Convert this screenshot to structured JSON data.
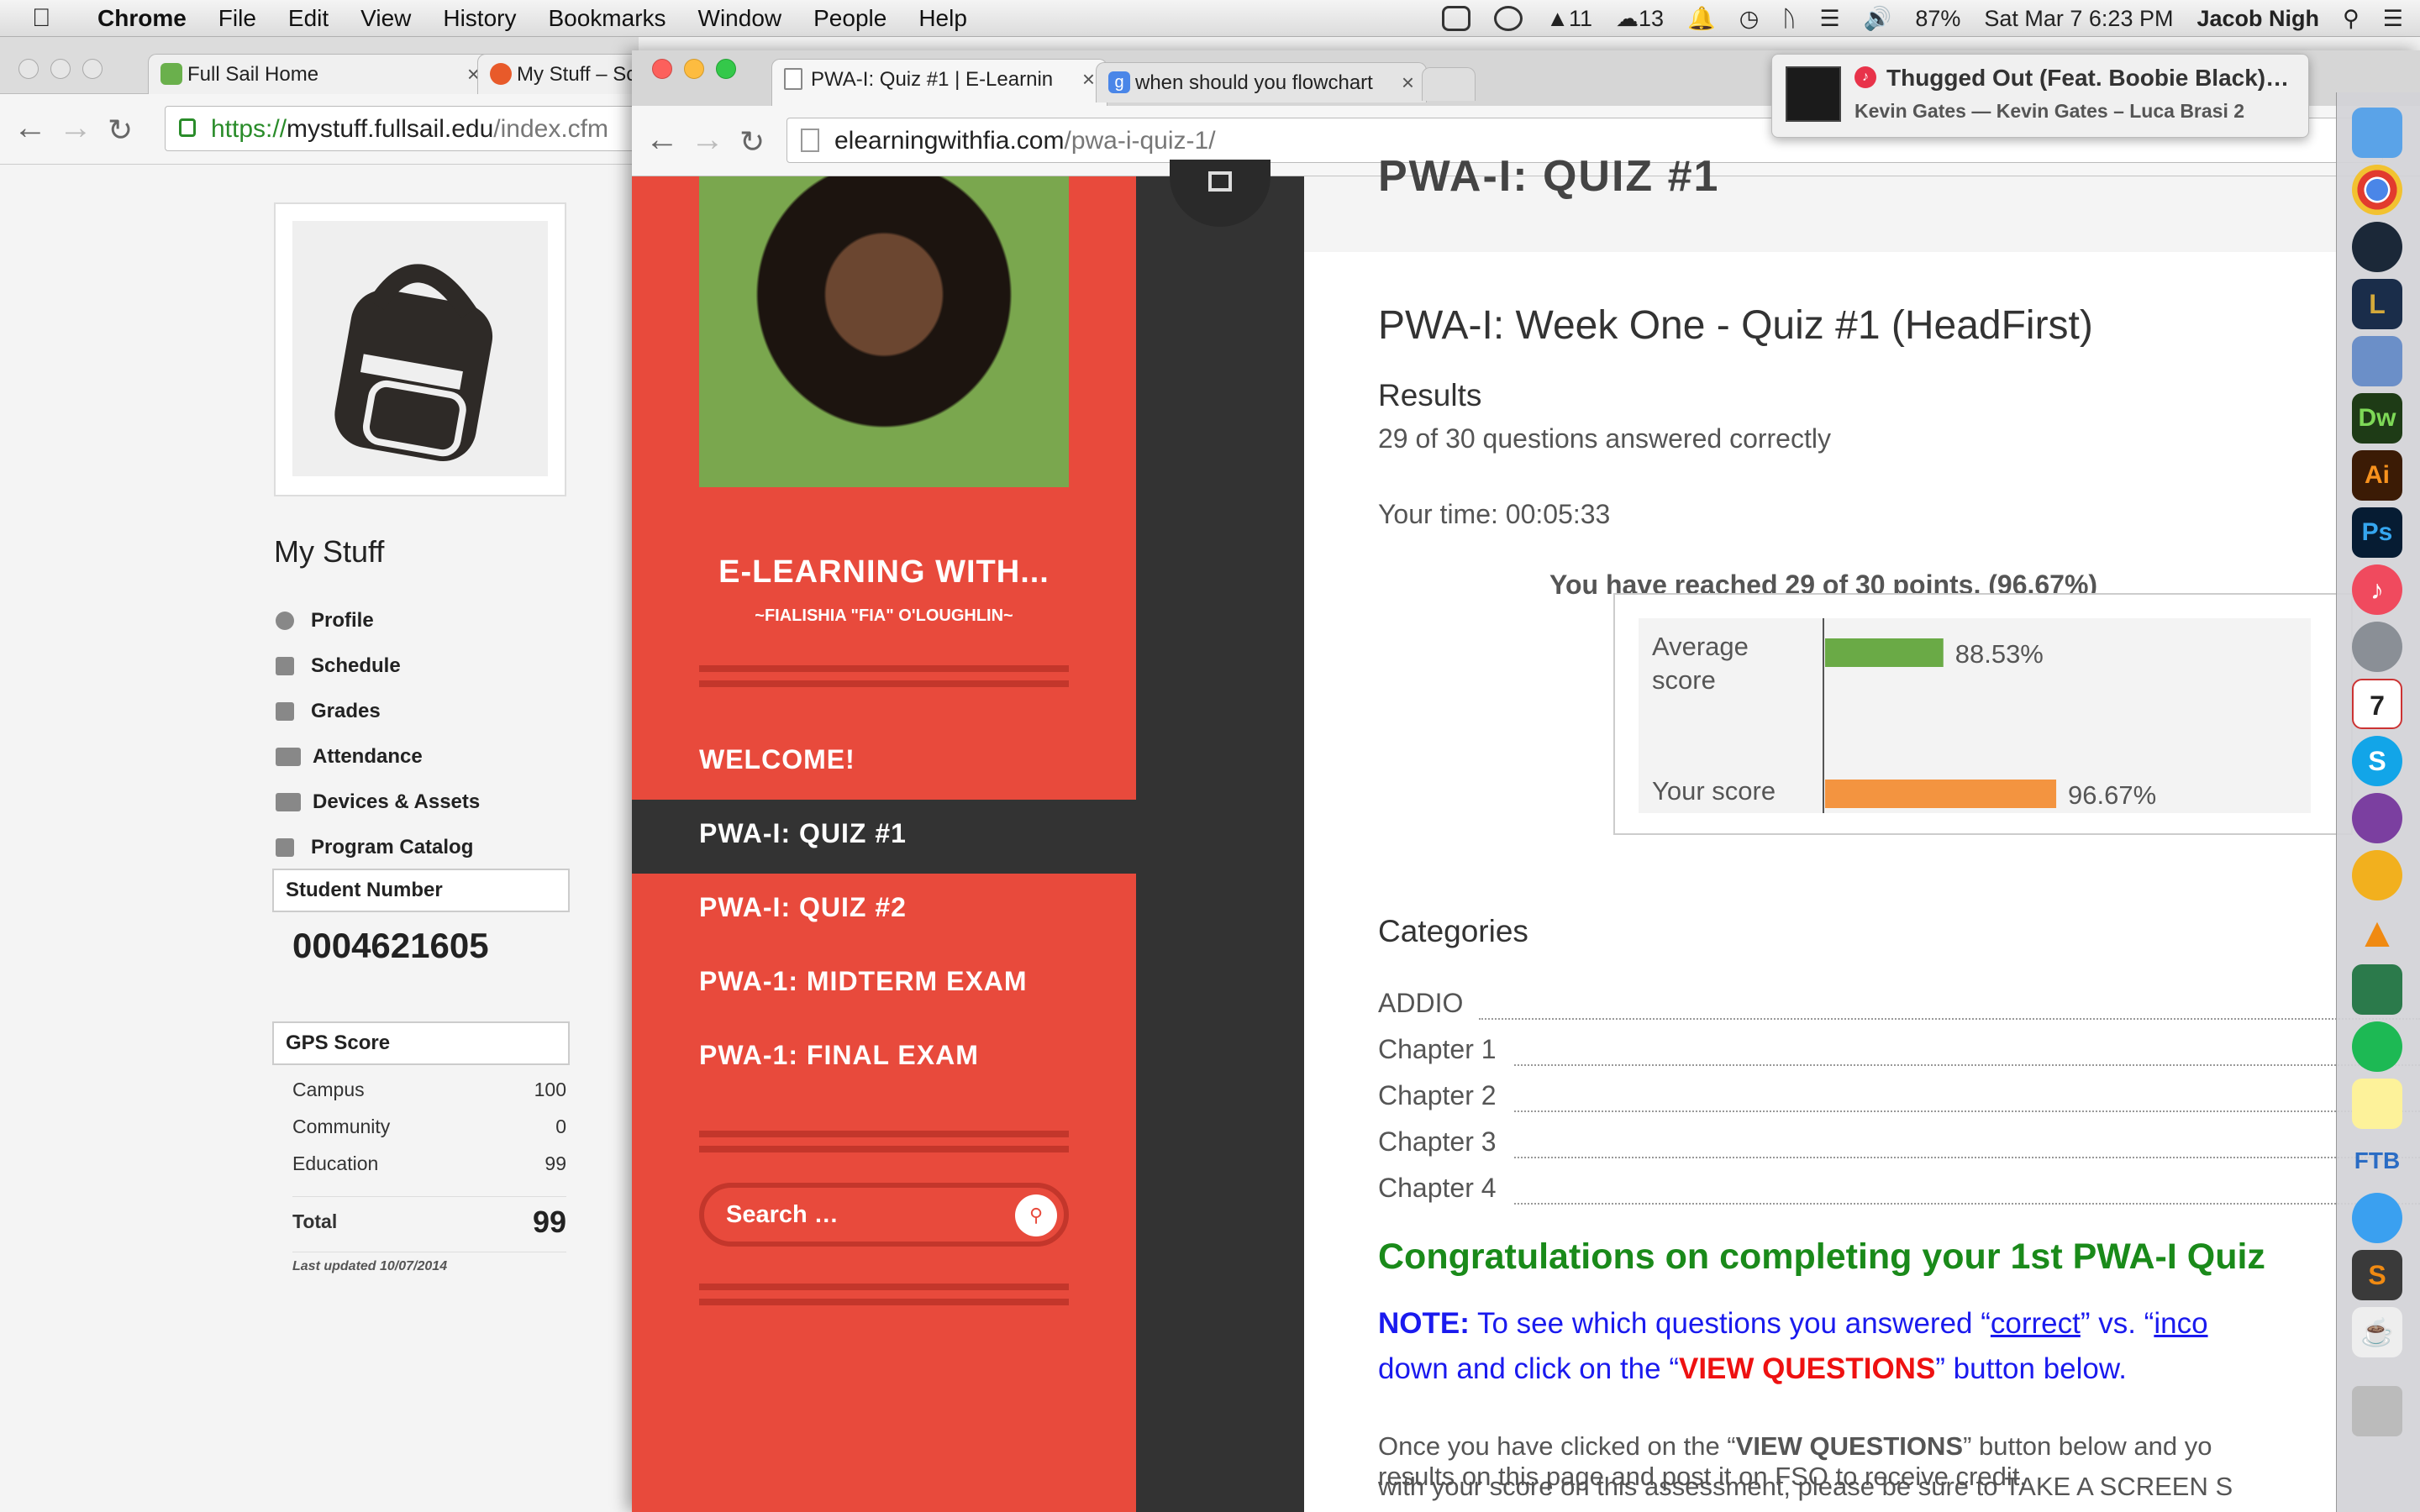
{
  "menubar": {
    "app": "Chrome",
    "items": [
      "File",
      "Edit",
      "View",
      "History",
      "Bookmarks",
      "Window",
      "People",
      "Help"
    ],
    "tray_count_1": "11",
    "tray_count_2": "13",
    "battery": "87%",
    "datetime": "Sat Mar 7  6:23 PM",
    "user": "Jacob Nigh"
  },
  "bg_window": {
    "tabs": [
      "Full Sail Home",
      "My Stuff – Sch"
    ],
    "url_prefix": "https://",
    "url_host": "mystuff.fullsail.edu",
    "url_path": "/index.cfm"
  },
  "mystuff": {
    "title": "My Stuff",
    "menu": [
      "Profile",
      "Schedule",
      "Grades",
      "Attendance",
      "Devices & Assets",
      "Program Catalog"
    ],
    "student_number_label": "Student Number",
    "student_number": "0004621605",
    "gps_label": "GPS Score",
    "gps_rows": [
      {
        "label": "Campus",
        "value": "100"
      },
      {
        "label": "Community",
        "value": "0"
      },
      {
        "label": "Education",
        "value": "99"
      }
    ],
    "total_label": "Total",
    "total_value": "99",
    "last_updated": "Last updated 10/07/2014"
  },
  "fg_window": {
    "tabs": [
      "PWA-I: Quiz #1 | E-Learnin",
      "when should you flowchart"
    ],
    "url_host": "elearningwithfia.com",
    "url_path": "/pwa-i-quiz-1/"
  },
  "sidebar": {
    "site_title": "E-LEARNING WITH...",
    "subtitle": "~FIALISHIA \"FIA\" O'LOUGHLIN~",
    "nav": [
      "WELCOME!",
      "PWA-I: QUIZ #1",
      "PWA-I: QUIZ #2",
      "PWA-1: MIDTERM EXAM",
      "PWA-1: FINAL EXAM"
    ],
    "search_placeholder": "Search …"
  },
  "main": {
    "header_title": "PWA-I: QUIZ #1",
    "quiz_title": "PWA-I: Week One - Quiz #1 (HeadFirst)",
    "results_label": "Results",
    "answered": "29 of 30 questions answered correctly",
    "time": "Your time: 00:05:33",
    "reached": "You have reached 29 of 30 points, (96.67%)",
    "categories_label": "Categories",
    "categories": [
      "ADDIO",
      "Chapter 1",
      "Chapter 2",
      "Chapter 3",
      "Chapter 4"
    ],
    "congrats": "Congratulations on completing your 1st PWA-I Quiz",
    "note_label": "NOTE:",
    "note_1": " To see which questions you answered “",
    "note_correct": "correct",
    "note_2": "” vs. “",
    "note_incorrect": "inco",
    "note_3": "down and click on the “",
    "note_view": "VIEW QUESTIONS",
    "note_4": "” button below.",
    "para_1a": "Once you have clicked on the “",
    "para_1b": "VIEW QUESTIONS",
    "para_1c": "” button below and yo",
    "para_2": "with your score on this assessment, please be sure to TAKE A SCREEN S",
    "para_3": "results on this page and post it on FSO to receive credit."
  },
  "chart_data": {
    "type": "bar",
    "orientation": "horizontal",
    "categories": [
      "Average score",
      "Your score"
    ],
    "values": [
      88.53,
      96.67
    ],
    "value_labels": [
      "88.53%",
      "96.67%"
    ],
    "colors": [
      "#6aaa46",
      "#f39440"
    ],
    "xlim": [
      0,
      100
    ],
    "title": "",
    "xlabel": "",
    "ylabel": ""
  },
  "notification": {
    "title": "Thugged Out (Feat. Boobie Black)…",
    "subtitle": "Kevin Gates — Kevin Gates – Luca Brasi 2"
  },
  "dock": {
    "labels": [
      "Dw",
      "Ai",
      "Ps",
      "7",
      "S"
    ]
  },
  "colors": {
    "sidebar_red": "#e84a3c",
    "dark": "#333333",
    "congrats_green": "#1a8a1a",
    "note_blue": "#1a1aee",
    "alert_red": "#ee1111"
  }
}
